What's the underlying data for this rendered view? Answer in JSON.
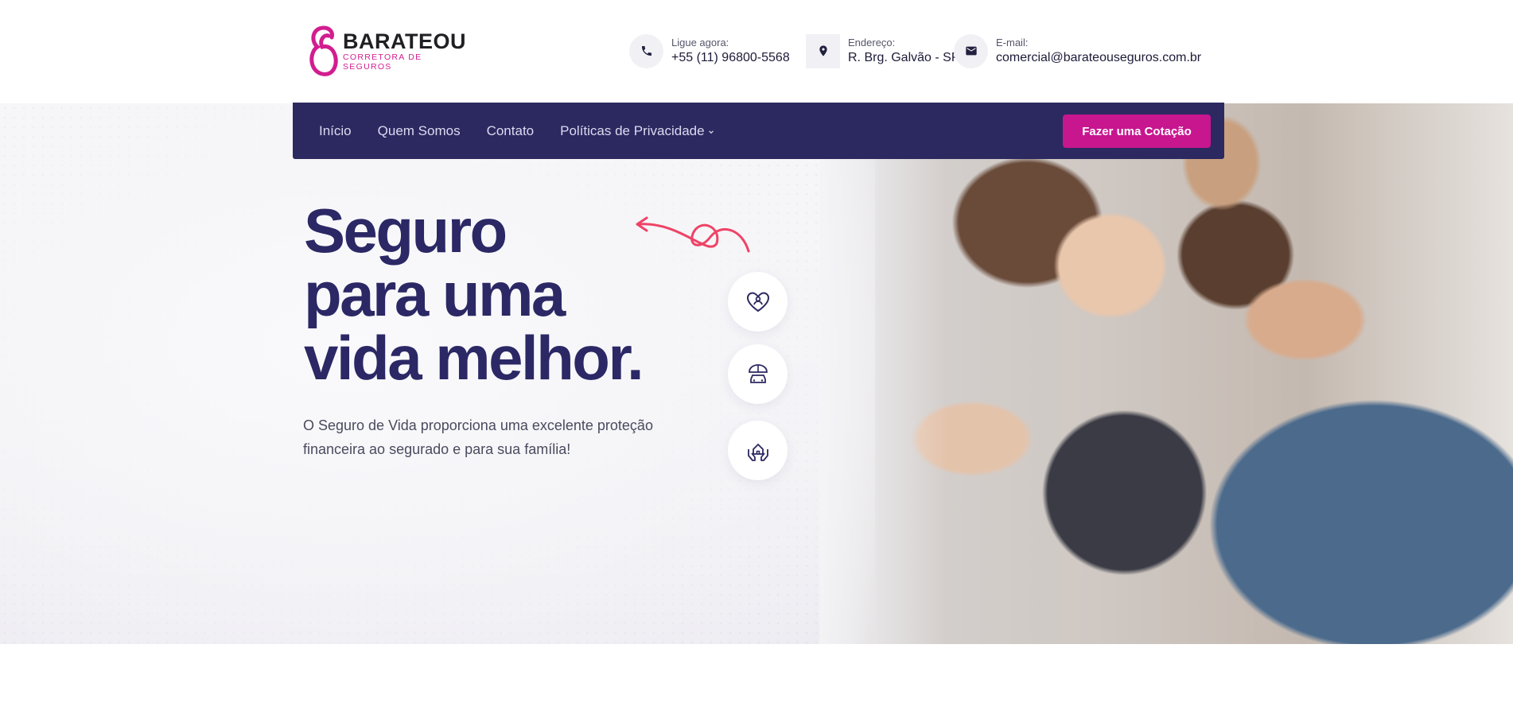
{
  "brand": {
    "name": "BARATEOU",
    "tagline": "CORRETORA DE SEGUROS",
    "accent_color": "#d21d8f",
    "primary_color": "#2c2960"
  },
  "contacts": [
    {
      "label": "Ligue agora:",
      "value": "+55 (11) 96800-5568",
      "icon": "phone-icon"
    },
    {
      "label": "Endereço:",
      "value": "R. Brg. Galvão - SP",
      "icon": "map-pin-icon"
    },
    {
      "label": "E-mail:",
      "value": "comercial@barateouseguros.com.br",
      "icon": "mail-icon"
    }
  ],
  "nav": {
    "items": [
      "Início",
      "Quem Somos",
      "Contato",
      "Políticas de Privacidade"
    ],
    "cta": "Fazer uma Cotação"
  },
  "hero": {
    "headline": [
      "Seguro",
      "para uma",
      "vida melhor."
    ],
    "subtext": "O Seguro de Vida proporciona uma excelente proteção financeira ao segurado e para sua família!",
    "features": [
      "heart-person-icon",
      "car-umbrella-icon",
      "house-hands-icon"
    ]
  }
}
